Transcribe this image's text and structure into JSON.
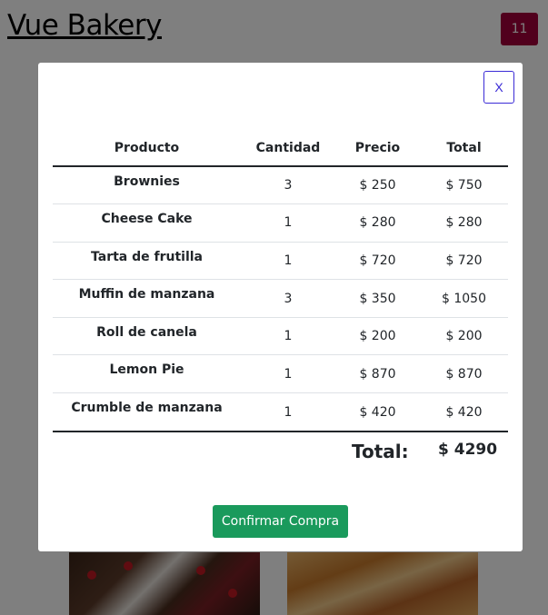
{
  "app": {
    "brand": "Vue Bakery",
    "cart_count": "11"
  },
  "modal": {
    "close_label": "X",
    "columns": [
      "Producto",
      "Cantidad",
      "Precio",
      "Total"
    ],
    "rows": [
      {
        "product": "Brownies",
        "qty": "3",
        "price": "$ 250",
        "total": "$ 750"
      },
      {
        "product": "Cheese Cake",
        "qty": "1",
        "price": "$ 280",
        "total": "$ 280"
      },
      {
        "product": "Tarta de frutilla",
        "qty": "1",
        "price": "$ 720",
        "total": "$ 720"
      },
      {
        "product": "Muffin de manzana",
        "qty": "3",
        "price": "$ 350",
        "total": "$ 1050"
      },
      {
        "product": "Roll de canela",
        "qty": "1",
        "price": "$ 200",
        "total": "$ 200"
      },
      {
        "product": "Lemon Pie",
        "qty": "1",
        "price": "$ 870",
        "total": "$ 870"
      },
      {
        "product": "Crumble de manzana",
        "qty": "1",
        "price": "$ 420",
        "total": "$ 420"
      }
    ],
    "total_label": "Total:",
    "total_value": "$ 4290",
    "confirm_label": "Confirmar Compra"
  },
  "colors": {
    "cart_badge": "#a3003a",
    "confirm_button": "#1a9a5c",
    "close_button_border": "#3b2bd6"
  }
}
